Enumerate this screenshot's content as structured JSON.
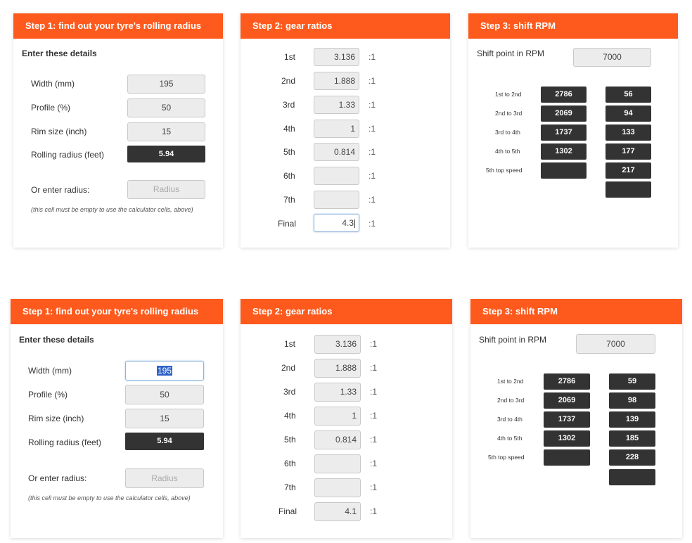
{
  "panels": [
    {
      "step1": {
        "title": "Step 1: find out your tyre's rolling radius",
        "intro": "Enter these details",
        "width_label": "Width (mm)",
        "width_value": "195",
        "profile_label": "Profile (%)",
        "profile_value": "50",
        "rim_label": "Rim size (inch)",
        "rim_value": "15",
        "rolling_label": "Rolling radius (feet)",
        "rolling_value": "5.94",
        "or_label": "Or enter radius:",
        "radius_placeholder": "Radius",
        "note": "(this cell must be empty to use the calculator cells, above)"
      },
      "step2": {
        "title": "Step 2: gear ratios",
        "ratio_suffix": ":1",
        "gears": [
          {
            "label": "1st",
            "value": "3.136"
          },
          {
            "label": "2nd",
            "value": "1.888"
          },
          {
            "label": "3rd",
            "value": "1.33"
          },
          {
            "label": "4th",
            "value": "1"
          },
          {
            "label": "5th",
            "value": "0.814"
          },
          {
            "label": "6th",
            "value": ""
          },
          {
            "label": "7th",
            "value": ""
          },
          {
            "label": "Final",
            "value": "4.3"
          }
        ]
      },
      "step3": {
        "title": "Step 3: shift RPM",
        "shift_label": "Shift point in RPM",
        "shift_value": "7000",
        "rows": [
          {
            "label": "1st to 2nd",
            "rpm": "2786",
            "speed": "56"
          },
          {
            "label": "2nd to 3rd",
            "rpm": "2069",
            "speed": "94"
          },
          {
            "label": "3rd to 4th",
            "rpm": "1737",
            "speed": "133"
          },
          {
            "label": "4th to 5th",
            "rpm": "1302",
            "speed": "177"
          },
          {
            "label": "5th top speed",
            "rpm": "",
            "speed": "217"
          },
          {
            "label": "",
            "rpm": null,
            "speed": ""
          }
        ]
      }
    },
    {
      "step1": {
        "title": "Step 1: find out your tyre's rolling radius",
        "intro": "Enter these details",
        "width_label": "Width (mm)",
        "width_value": "195",
        "profile_label": "Profile (%)",
        "profile_value": "50",
        "rim_label": "Rim size (inch)",
        "rim_value": "15",
        "rolling_label": "Rolling radius (feet)",
        "rolling_value": "5.94",
        "or_label": "Or enter radius:",
        "radius_placeholder": "Radius",
        "note": "(this cell must be empty to use the calculator cells, above)"
      },
      "step2": {
        "title": "Step 2: gear ratios",
        "ratio_suffix": ":1",
        "gears": [
          {
            "label": "1st",
            "value": "3.136"
          },
          {
            "label": "2nd",
            "value": "1.888"
          },
          {
            "label": "3rd",
            "value": "1.33"
          },
          {
            "label": "4th",
            "value": "1"
          },
          {
            "label": "5th",
            "value": "0.814"
          },
          {
            "label": "6th",
            "value": ""
          },
          {
            "label": "7th",
            "value": ""
          },
          {
            "label": "Final",
            "value": "4.1"
          }
        ]
      },
      "step3": {
        "title": "Step 3: shift RPM",
        "shift_label": "Shift point in RPM",
        "shift_value": "7000",
        "rows": [
          {
            "label": "1st to 2nd",
            "rpm": "2786",
            "speed": "59"
          },
          {
            "label": "2nd to 3rd",
            "rpm": "2069",
            "speed": "98"
          },
          {
            "label": "3rd to 4th",
            "rpm": "1737",
            "speed": "139"
          },
          {
            "label": "4th to 5th",
            "rpm": "1302",
            "speed": "185"
          },
          {
            "label": "5th top speed",
            "rpm": "",
            "speed": "228"
          },
          {
            "label": "",
            "rpm": null,
            "speed": ""
          }
        ]
      }
    }
  ]
}
